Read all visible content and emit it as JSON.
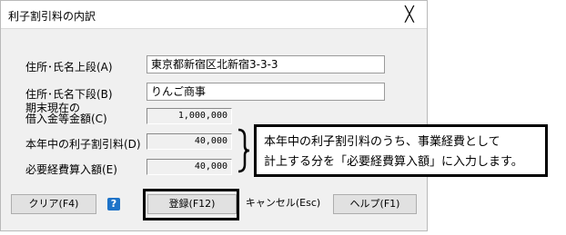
{
  "window": {
    "title": "利子割引料の内訳",
    "close_glyph": "╳"
  },
  "form": {
    "address_upper_label": "住所･氏名上段(A)",
    "address_upper_value": "東京都新宿区北新宿3-3-3",
    "address_lower_label": "住所･氏名下段(B)",
    "address_lower_value": "りんご商事",
    "borrowing_label_line1": "期末現在の",
    "borrowing_label_line2": "借入金等金額(C)",
    "borrowing_value": "1,000,000",
    "interest_label": "本年中の利子割引料(D)",
    "interest_value": "40,000",
    "expense_label": "必要経費算入額(E)",
    "expense_value": "40,000"
  },
  "buttons": {
    "clear": "クリア(F4)",
    "help_icon_glyph": "?",
    "register": "登録(F12)",
    "cancel": "キャンセル(Esc)",
    "help": "ヘルプ(F1)"
  },
  "callout": {
    "line1": "本年中の利子割引料のうち、事業経費として",
    "line2": "計上する分を「必要経費算入額」に入力します。"
  },
  "colors": {
    "window_bg": "#f0f0f0",
    "help_icon": "#1e73c8"
  },
  "icons": {
    "close": "close-icon",
    "help": "question-icon"
  }
}
